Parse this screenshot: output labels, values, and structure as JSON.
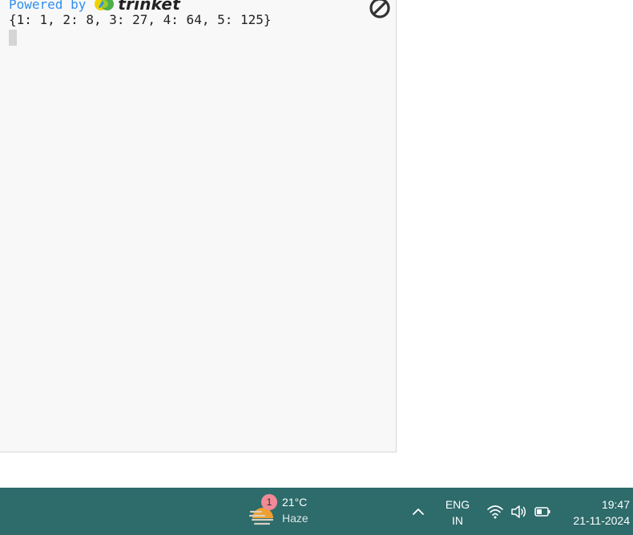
{
  "console": {
    "powered_by_label": "Powered by",
    "brand_name": "trinket",
    "output_line": "{1: 1, 2: 8, 3: 27, 4: 64, 5: 125}",
    "clear_icon": "no-entry-icon"
  },
  "taskbar": {
    "weather": {
      "badge_count": "1",
      "temperature": "21°C",
      "condition": "Haze",
      "icon": "haze-weather-icon"
    },
    "language": {
      "line1": "ENG",
      "line2": "IN"
    },
    "tray_icons": [
      "chevron-up-icon",
      "wifi-icon",
      "volume-icon",
      "battery-icon"
    ],
    "clock": {
      "time": "19:47",
      "date": "21-11-2024"
    },
    "background_color": "#2e6b6b"
  }
}
